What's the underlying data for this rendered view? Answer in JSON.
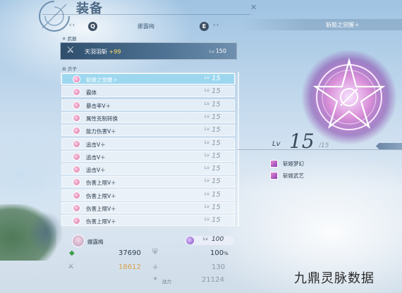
{
  "header": {
    "title": "装备",
    "tab_name": "娜露梅",
    "prev_key": "Q",
    "next_key": "E"
  },
  "weapon_section": {
    "label": "武器",
    "weapon_name": "天羽羽斩",
    "weapon_plus": "+99",
    "lv_label": "Lv",
    "lv_value": "150"
  },
  "core_section": {
    "label": "贝子",
    "items": [
      {
        "name": "斩姬之觉醒＋",
        "lv_label": "Lv",
        "lv": "15",
        "selected": true
      },
      {
        "name": "霸体",
        "lv_label": "Lv",
        "lv": "15",
        "selected": false
      },
      {
        "name": "暴击率Ⅴ＋",
        "lv_label": "Lv",
        "lv": "15",
        "selected": false
      },
      {
        "name": "属性克制转换",
        "lv_label": "Lv",
        "lv": "15",
        "selected": false
      },
      {
        "name": "能力伤害Ⅴ＋",
        "lv_label": "Lv",
        "lv": "15",
        "selected": false
      },
      {
        "name": "追击Ⅴ＋",
        "lv_label": "Lv",
        "lv": "15",
        "selected": false
      },
      {
        "name": "追击Ⅴ＋",
        "lv_label": "Lv",
        "lv": "15",
        "selected": false
      },
      {
        "name": "追击Ⅴ＋",
        "lv_label": "Lv",
        "lv": "15",
        "selected": false
      },
      {
        "name": "伤害上限Ⅴ＋",
        "lv_label": "Lv",
        "lv": "15",
        "selected": false
      },
      {
        "name": "伤害上限Ⅴ＋",
        "lv_label": "Lv",
        "lv": "15",
        "selected": false
      },
      {
        "name": "伤害上限Ⅴ＋",
        "lv_label": "Lv",
        "lv": "15",
        "selected": false
      },
      {
        "name": "伤害上限Ⅴ＋",
        "lv_label": "Lv",
        "lv": "15",
        "selected": false
      }
    ]
  },
  "character": {
    "name": "娜露梅",
    "lv_label": "Lv",
    "lv_value": "100",
    "hp": "37690",
    "hp_pct": "100",
    "hp_pct_unit": "%",
    "attack": "18612",
    "stat_right": "130",
    "power_label": "战力",
    "power": "21124"
  },
  "detail": {
    "title": "斩姬之觉醒＋",
    "lv_label": "Lv",
    "lv_value": "15",
    "lv_max": "15",
    "skills": [
      "斩姬梦幻",
      "斩姬武艺"
    ]
  },
  "watermark": "九鼎灵脉数据",
  "colors": {
    "selected_row": "#96d7f0",
    "weapon_bar": "#2f4e6c",
    "hp_green": "#3e9a4a",
    "attack_gold": "#d8a24c",
    "emblem_pink": "#d98fd8"
  }
}
